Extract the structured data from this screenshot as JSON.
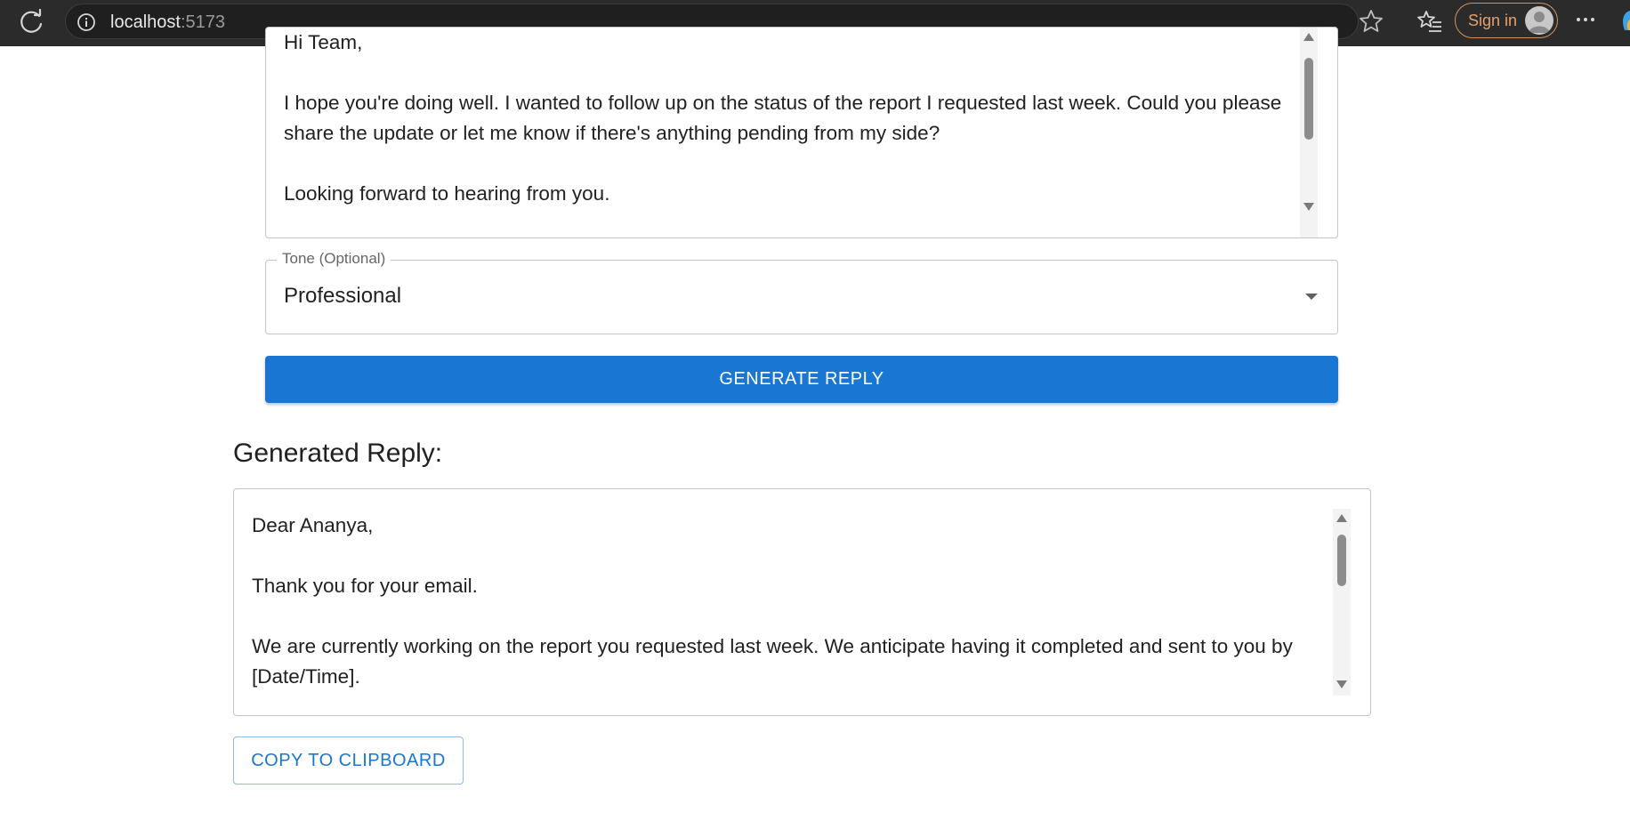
{
  "browser": {
    "url_host": "localhost",
    "url_port": ":5173",
    "signin_label": "Sign in"
  },
  "email": {
    "lines": [
      "Hi Team,",
      "",
      "I hope you're doing well. I wanted to follow up on the status of the report I requested last week. Could you please share the update or let me know if there's anything pending from my side?",
      "",
      "Looking forward to hearing from you."
    ]
  },
  "tone": {
    "label": "Tone (Optional)",
    "value": "Professional"
  },
  "generate_button": "GENERATE REPLY",
  "reply": {
    "heading": "Generated Reply:",
    "lines": [
      "Dear Ananya,",
      "",
      "Thank you for your email.",
      "",
      "We are currently working on the report you requested last week. We anticipate having it completed and sent to you by [Date/Time]."
    ]
  },
  "copy_button": "COPY TO CLIPBOARD",
  "colors": {
    "primary": "#1976d2",
    "chrome_bg": "#2b2b2b",
    "signin_accent": "#e7a06b"
  }
}
